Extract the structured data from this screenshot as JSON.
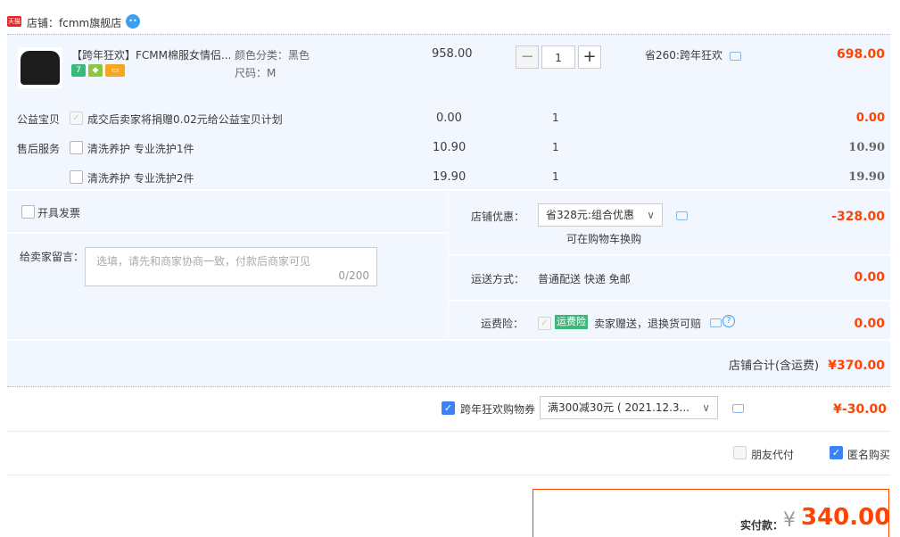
{
  "shop": {
    "label": "店铺：",
    "name": "fcmm旗舰店",
    "badge": "天猫"
  },
  "item": {
    "title": "【跨年狂欢】FCMM棉服女情侣...",
    "color_label": "颜色分类：黑色",
    "size_label": "尺码：M",
    "price": "958.00",
    "quantity": "1",
    "qty_minus": "−",
    "qty_plus": "+",
    "discount_label": "省260:跨年狂欢",
    "subtotal": "698.00"
  },
  "addons": [
    {
      "section": "公益宝贝",
      "label": "成交后卖家将捐赠0.02元给公益宝贝计划",
      "price": "0.00",
      "qty": "1",
      "total": "0.00"
    },
    {
      "section": "售后服务",
      "label": "清洗养护 专业洗护1件",
      "price": "10.90",
      "qty": "1",
      "total": "10.90"
    },
    {
      "section": "",
      "label": "清洗养护 专业洗护2件",
      "price": "19.90",
      "qty": "1",
      "total": "19.90"
    }
  ],
  "invoice": {
    "label": "开具发票"
  },
  "message": {
    "label": "给卖家留言：",
    "placeholder": "选填，请先和商家协商一致，付款后商家可见",
    "counter": "0/200"
  },
  "shop_discount": {
    "label": "店铺优惠：",
    "selected": "省328元:组合优惠",
    "hint": "可在购物车换购",
    "amount": "-328.00"
  },
  "shipping": {
    "label": "运送方式：",
    "value": "普通配送 快递 免邮",
    "amount": "0.00"
  },
  "insurance": {
    "label": "运费险：",
    "tag": "运费险",
    "value": "卖家赠送，退换货可赔",
    "amount": "0.00"
  },
  "shop_total": {
    "label": "店铺合计(含运费)",
    "amount": "¥370.00"
  },
  "coupon": {
    "label": "跨年狂欢购物券",
    "selected": "满300减30元 ( 2021.12.3...",
    "amount": "¥-30.00"
  },
  "options": {
    "friend_pay": "朋友代付",
    "anonymous": "匿名购买"
  },
  "payment": {
    "label": "实付款：",
    "currency": "¥",
    "amount": "340.00"
  },
  "colors": {
    "accent": "#ff4400",
    "bg_blue": "#f2f7ff",
    "checkbox": "#3b82f6"
  }
}
